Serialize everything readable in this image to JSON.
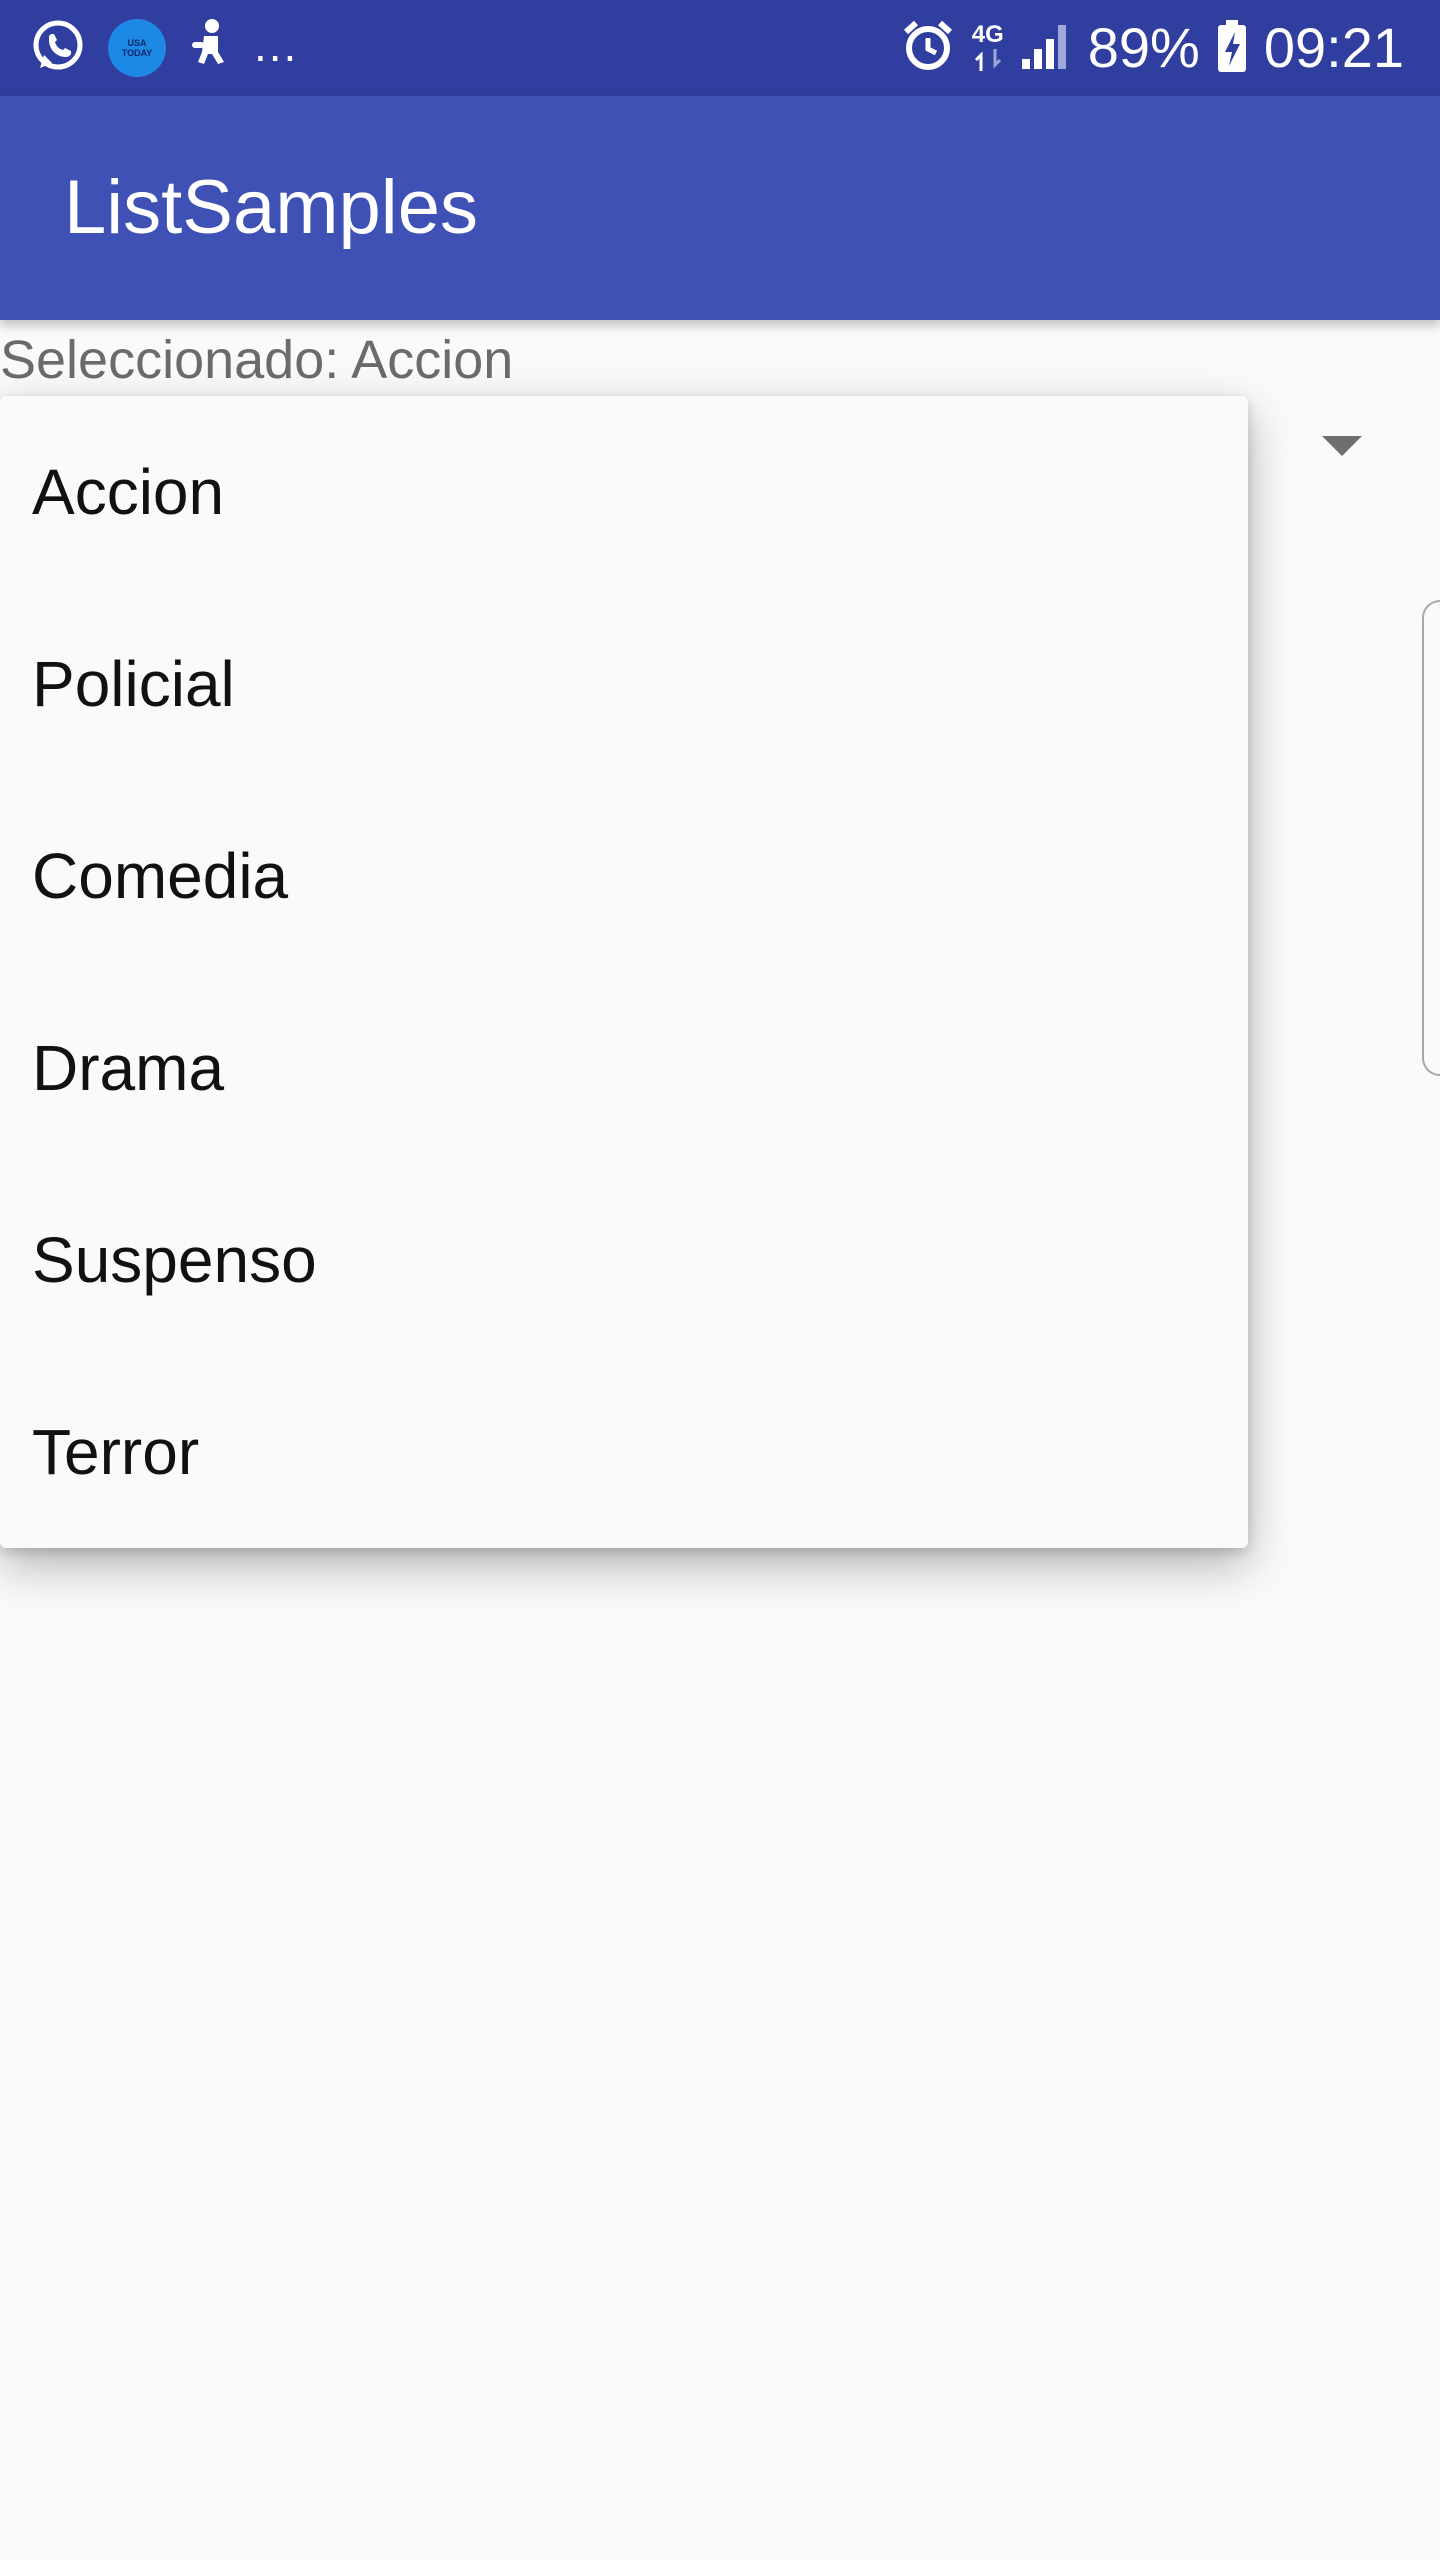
{
  "status_bar": {
    "left_icons": [
      "whatsapp-icon",
      "usa-today-icon",
      "person-icon"
    ],
    "usa_today_line1": "USA",
    "usa_today_line2": "TODAY",
    "overflow": "...",
    "network_type": "4G",
    "battery": "89%",
    "time": "09:21"
  },
  "app_bar": {
    "title": "ListSamples"
  },
  "content": {
    "selected_text": "Seleccionado: Accion"
  },
  "dropdown": {
    "items": [
      "Accion",
      "Policial",
      "Comedia",
      "Drama",
      "Suspenso",
      "Terror"
    ]
  },
  "colors": {
    "status_bar": "#303f9f",
    "app_bar": "#3f51b5",
    "background": "#fafafa"
  }
}
